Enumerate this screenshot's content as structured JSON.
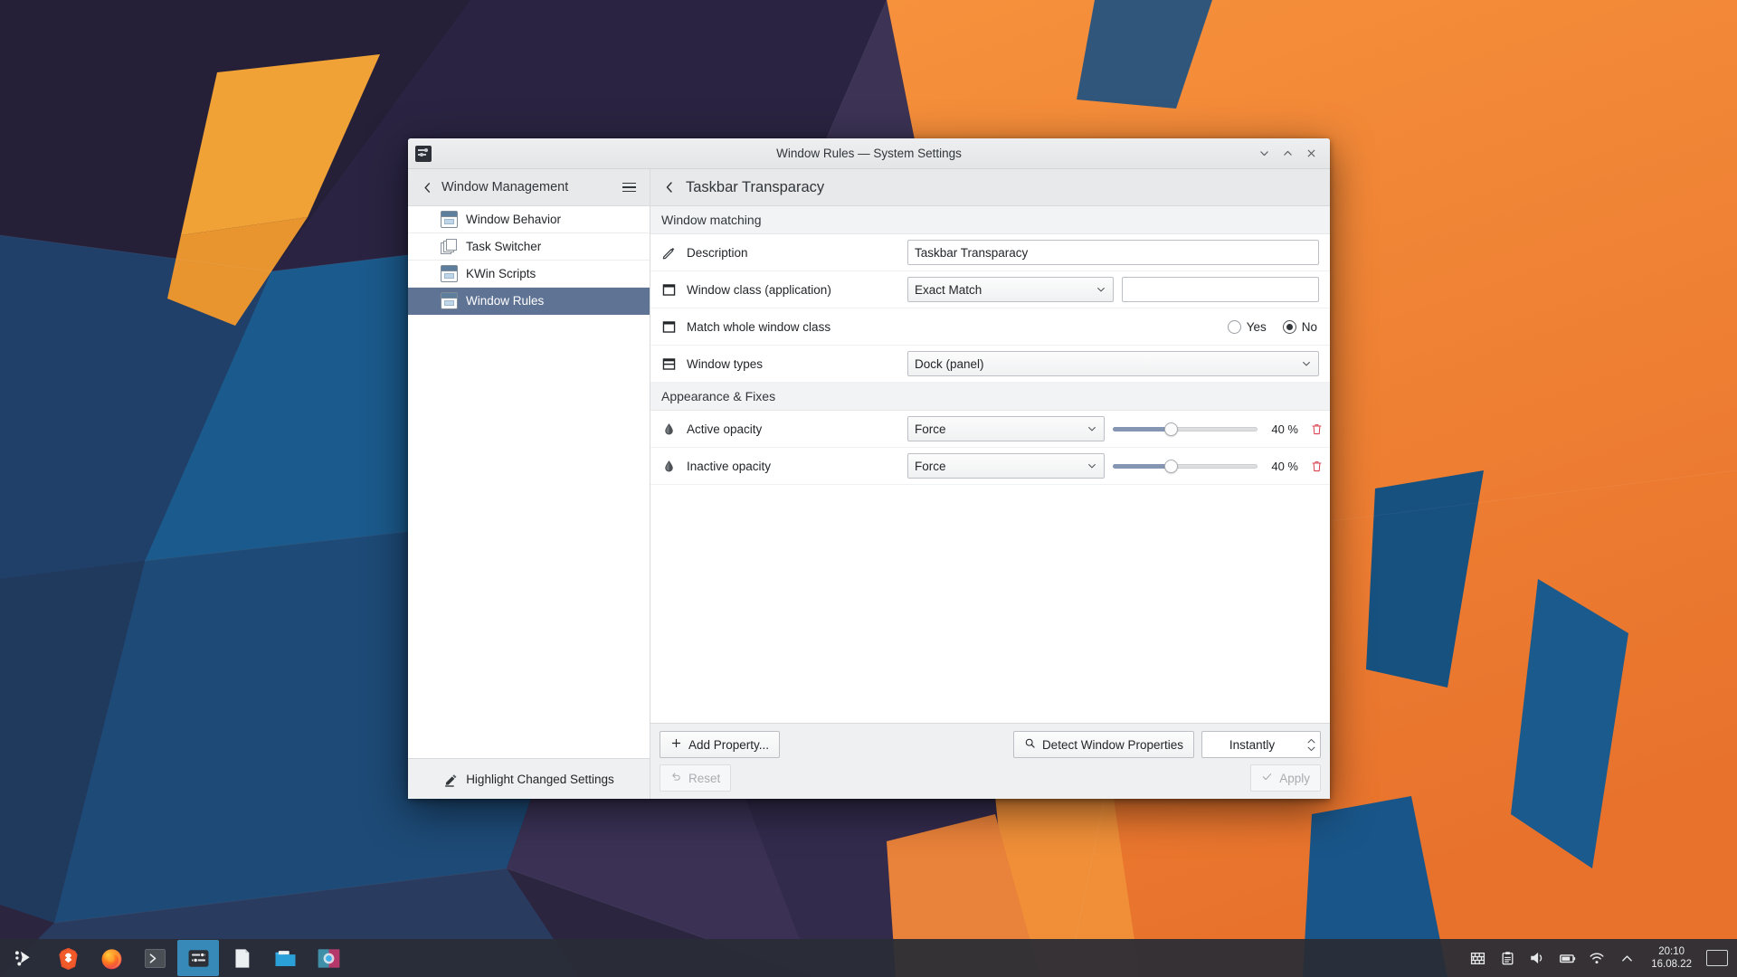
{
  "window": {
    "title": "Window Rules — System Settings",
    "icon": "system-settings-icon",
    "controls": {
      "minimize": "chevron-down-icon",
      "maximize": "chevron-up-icon",
      "close": "close-icon"
    }
  },
  "sidebar": {
    "back_label": "Window Management",
    "menu_icon": "hamburger-icon",
    "items": [
      {
        "label": "Window Behavior",
        "icon": "window-icon",
        "selected": false
      },
      {
        "label": "Task Switcher",
        "icon": "stacked-windows-icon",
        "selected": false
      },
      {
        "label": "KWin Scripts",
        "icon": "window-icon",
        "selected": false
      },
      {
        "label": "Window Rules",
        "icon": "window-icon",
        "selected": true
      }
    ],
    "footer": {
      "label": "Highlight Changed Settings",
      "icon": "highlighter-icon"
    }
  },
  "main": {
    "title": "Taskbar Transparacy",
    "back_icon": "chevron-left-icon",
    "sections": [
      {
        "heading": "Window matching",
        "rows": [
          {
            "label": "Description",
            "icon": "pencil-icon",
            "type": "text",
            "value": "Taskbar Transparacy",
            "placeholder": ""
          },
          {
            "label": "Window class (application)",
            "icon": "window-frame-icon",
            "type": "combo-and-text",
            "combo_value": "Exact Match",
            "text_value": "",
            "placeholder": ""
          },
          {
            "label": "Match whole window class",
            "icon": "window-frame-icon",
            "type": "radio",
            "options": [
              "Yes",
              "No"
            ],
            "selected": "No"
          },
          {
            "label": "Window types",
            "icon": "window-types-icon",
            "type": "combo-wide",
            "combo_value": "Dock (panel)"
          }
        ]
      },
      {
        "heading": "Appearance & Fixes",
        "rows": [
          {
            "label": "Active opacity",
            "icon": "opacity-drop-icon",
            "type": "combo-slider",
            "combo_value": "Force",
            "slider_value": 40,
            "slider_min": 0,
            "slider_max": 100,
            "percent_label": "40 %",
            "delete_icon": "trash-icon"
          },
          {
            "label": "Inactive opacity",
            "icon": "opacity-drop-icon",
            "type": "combo-slider",
            "combo_value": "Force",
            "slider_value": 40,
            "slider_min": 0,
            "slider_max": 100,
            "percent_label": "40 %",
            "delete_icon": "trash-icon"
          }
        ]
      }
    ],
    "bottom_bar": {
      "add_property": "Add Property...",
      "detect_window_properties": "Detect Window Properties",
      "apply_mode": "Instantly",
      "reset": "Reset",
      "apply": "Apply"
    }
  },
  "taskbar": {
    "apps": [
      {
        "name": "application-launcher",
        "active": false
      },
      {
        "name": "brave-browser",
        "active": false
      },
      {
        "name": "firefox",
        "active": false
      },
      {
        "name": "terminal",
        "active": false
      },
      {
        "name": "system-settings",
        "active": true
      },
      {
        "name": "text-document",
        "active": false
      },
      {
        "name": "file-manager",
        "active": false
      },
      {
        "name": "screenshot-tool",
        "active": false
      }
    ],
    "tray": [
      "firewall-icon",
      "clipboard-icon",
      "volume-icon",
      "battery-icon",
      "wifi-icon",
      "show-hidden-icon"
    ],
    "clock": {
      "time": "20:10",
      "date": "16.08.22"
    },
    "pager": "desktop-pager"
  },
  "colors": {
    "accent": "#3daee9",
    "selection": "#5f7394",
    "window_bg": "#eff0f1",
    "slider_fill": "#8496b3",
    "trash_red": "#da4453"
  }
}
